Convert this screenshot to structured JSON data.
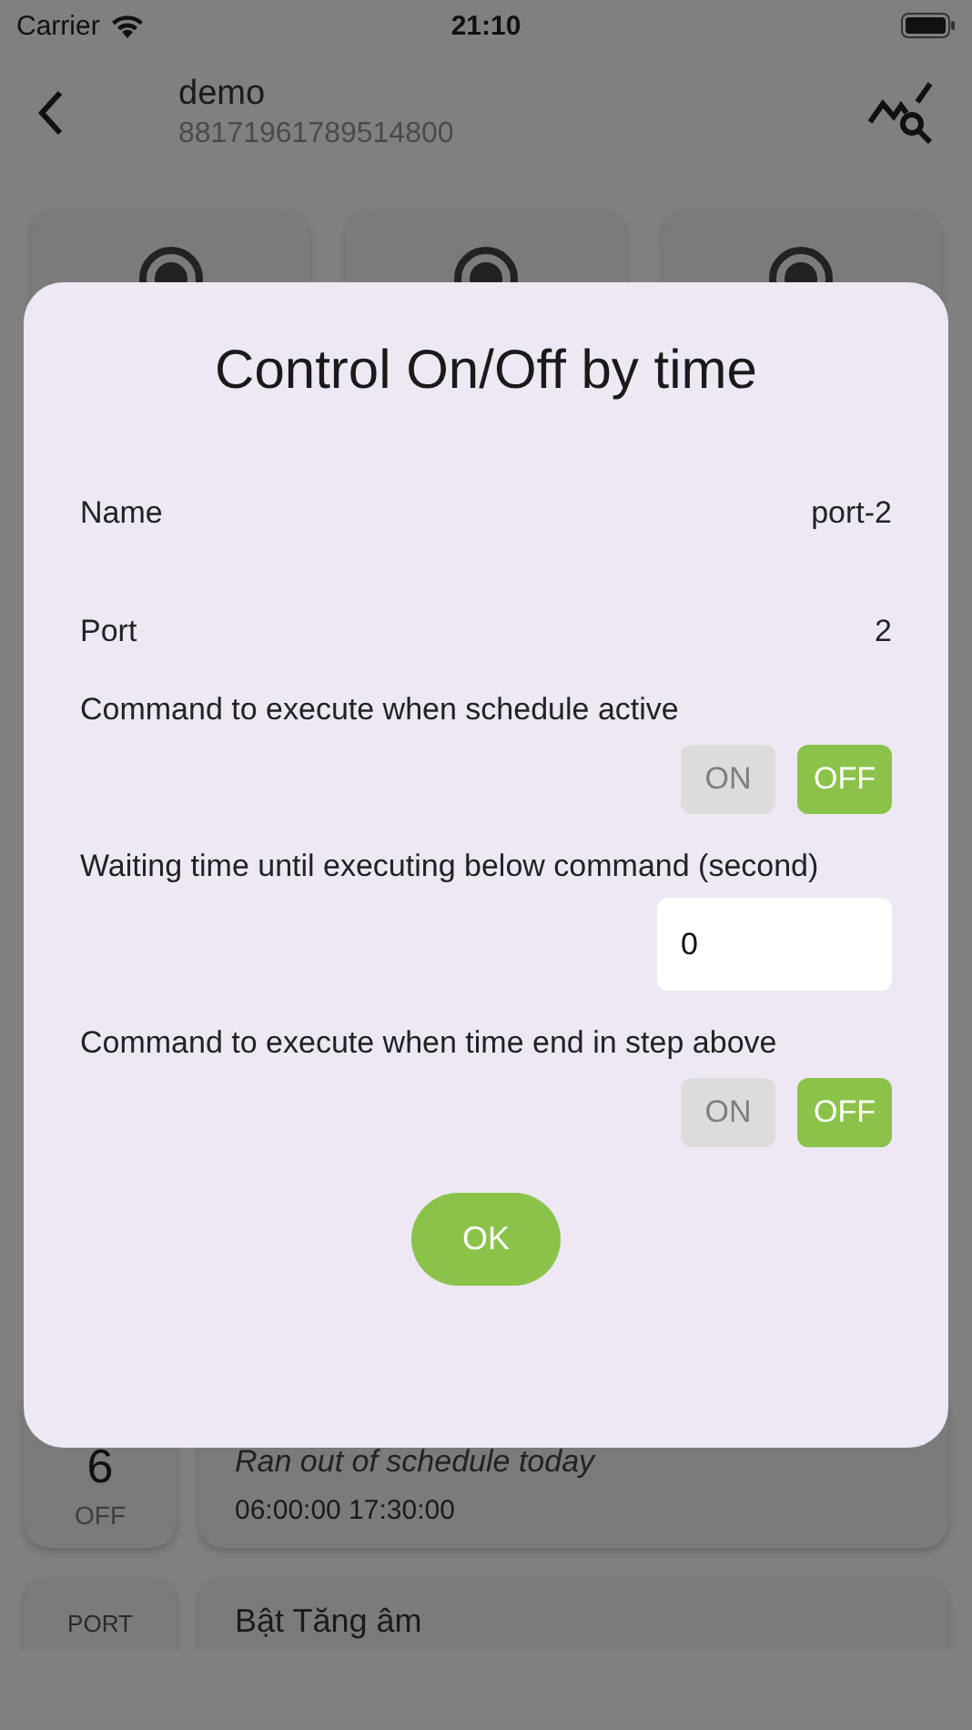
{
  "status_bar": {
    "carrier": "Carrier",
    "time": "21:10"
  },
  "header": {
    "title": "demo",
    "subtitle": "88171961789514800"
  },
  "top_cards": [
    {
      "kind": "radio"
    },
    {
      "kind": "radio"
    },
    {
      "kind": "radio"
    }
  ],
  "schedules": [
    {
      "port_number": "6",
      "state": "OFF",
      "status": "Ran out of schedule today",
      "times": "06:00:00 17:30:00"
    },
    {
      "port_label": "PORT",
      "name": "Bật Tăng âm"
    }
  ],
  "dialog": {
    "title": "Control On/Off by time",
    "fields": [
      {
        "kind": "value",
        "label": "Name",
        "value": "port-2"
      },
      {
        "kind": "value",
        "label": "Port",
        "value": "2"
      },
      {
        "kind": "toggle",
        "label": "Command to execute when schedule active",
        "options": [
          {
            "label": "ON",
            "selected": false
          },
          {
            "label": "OFF",
            "selected": true
          }
        ]
      },
      {
        "kind": "input",
        "label": "Waiting time until executing below command (second)",
        "value": "0"
      },
      {
        "kind": "toggle",
        "label": "Command to execute when time end in step above",
        "options": [
          {
            "label": "ON",
            "selected": false
          },
          {
            "label": "OFF",
            "selected": true
          }
        ]
      }
    ],
    "ok_button": "OK"
  }
}
